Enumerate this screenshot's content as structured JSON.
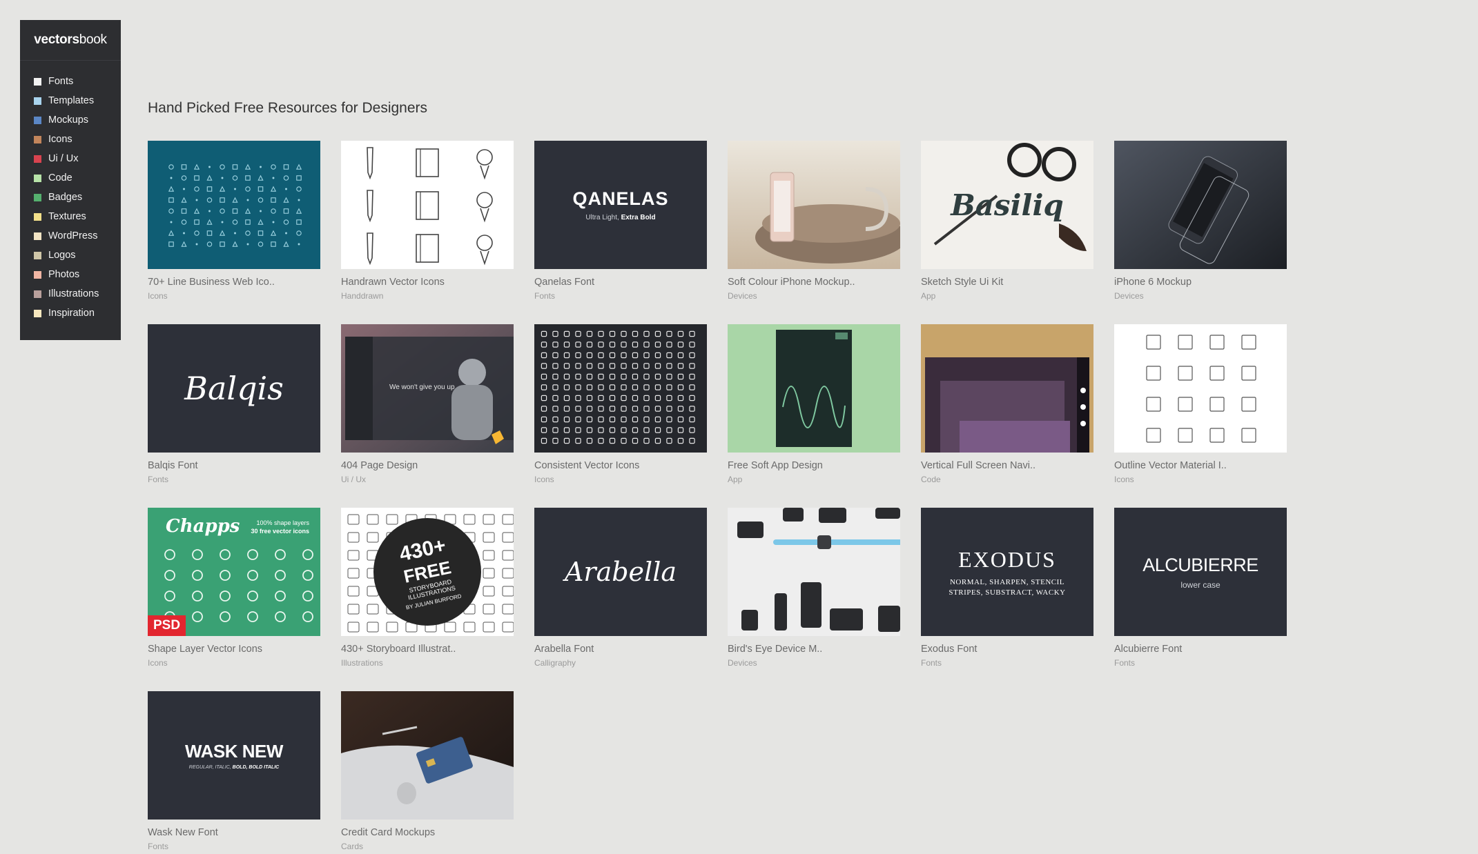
{
  "brand": {
    "bold": "vectors",
    "light": "book"
  },
  "nav": [
    {
      "label": "Fonts",
      "color": "#f2f2f2"
    },
    {
      "label": "Templates",
      "color": "#a9d4ee"
    },
    {
      "label": "Mockups",
      "color": "#5b87c6"
    },
    {
      "label": "Icons",
      "color": "#c2855b"
    },
    {
      "label": "Ui / Ux",
      "color": "#d8434f"
    },
    {
      "label": "Code",
      "color": "#b7e3a8"
    },
    {
      "label": "Badges",
      "color": "#55b06e"
    },
    {
      "label": "Textures",
      "color": "#f3e08a"
    },
    {
      "label": "WordPress",
      "color": "#f2e4c4"
    },
    {
      "label": "Logos",
      "color": "#cfc6a8"
    },
    {
      "label": "Photos",
      "color": "#f1b6a4"
    },
    {
      "label": "Illustrations",
      "color": "#b9a09c"
    },
    {
      "label": "Inspiration",
      "color": "#f7e8bf"
    }
  ],
  "heading": "Hand Picked Free Resources for Designers",
  "cards": [
    {
      "title": "70+ Line Business Web Ico..",
      "category": "Icons"
    },
    {
      "title": "Handrawn Vector Icons",
      "category": "Handdrawn"
    },
    {
      "title": "Qanelas Font",
      "category": "Fonts",
      "art": {
        "name": "QANELAS",
        "sub1": "Ultra Light, ",
        "sub2": "Extra Bold"
      }
    },
    {
      "title": "Soft Colour iPhone Mockup..",
      "category": "Devices"
    },
    {
      "title": "Sketch Style Ui Kit",
      "category": "App",
      "art": {
        "name": "Basiliq"
      }
    },
    {
      "title": "iPhone 6 Mockup",
      "category": "Devices"
    },
    {
      "title": "Balqis Font",
      "category": "Fonts",
      "art": {
        "name": "Balqis"
      }
    },
    {
      "title": "404 Page Design",
      "category": "Ui / Ux",
      "art": {
        "name": "We won't give you up"
      }
    },
    {
      "title": "Consistent Vector Icons",
      "category": "Icons"
    },
    {
      "title": "Free Soft App Design",
      "category": "App"
    },
    {
      "title": "Vertical Full Screen Navi..",
      "category": "Code"
    },
    {
      "title": "Outline Vector Material I..",
      "category": "Icons"
    },
    {
      "title": "Shape Layer Vector Icons",
      "category": "Icons",
      "art": {
        "name": "Chapps",
        "sub1": "100% shape layers",
        "sub2": "30 free vector icons",
        "badge": "PSD"
      }
    },
    {
      "title": "430+ Storyboard Illustrat..",
      "category": "Illustrations",
      "art": {
        "name": "430+",
        "sub1": "FREE",
        "sub2": "STORYBOARD ILLUSTRATIONS",
        "sub3": "BY JULIAN BURFORD"
      }
    },
    {
      "title": "Arabella Font",
      "category": "Calligraphy",
      "art": {
        "name": "Arabella"
      }
    },
    {
      "title": "Bird's Eye Device M..",
      "category": "Devices"
    },
    {
      "title": "Exodus Font",
      "category": "Fonts",
      "art": {
        "name": "EXODUS",
        "sub1": "NORMAL, SHARPEN, STENCIL",
        "sub2": "STRIPES, SUBSTRACT, WACKY"
      }
    },
    {
      "title": "Alcubierre Font",
      "category": "Fonts",
      "art": {
        "name": "ALCUBIERRE",
        "sub1": "lower case"
      }
    },
    {
      "title": "Wask New Font",
      "category": "Fonts",
      "art": {
        "name": "WASK NEW",
        "sub1": "REGULAR, ITALIC, ",
        "sub2": "BOLD, BOLD ITALIC"
      }
    },
    {
      "title": "Credit Card Mockups",
      "category": "Cards"
    }
  ],
  "colors": {
    "dark_tile": "#2d3039",
    "teal_tile": "#0f5d74",
    "green_tile": "#3aa174"
  }
}
